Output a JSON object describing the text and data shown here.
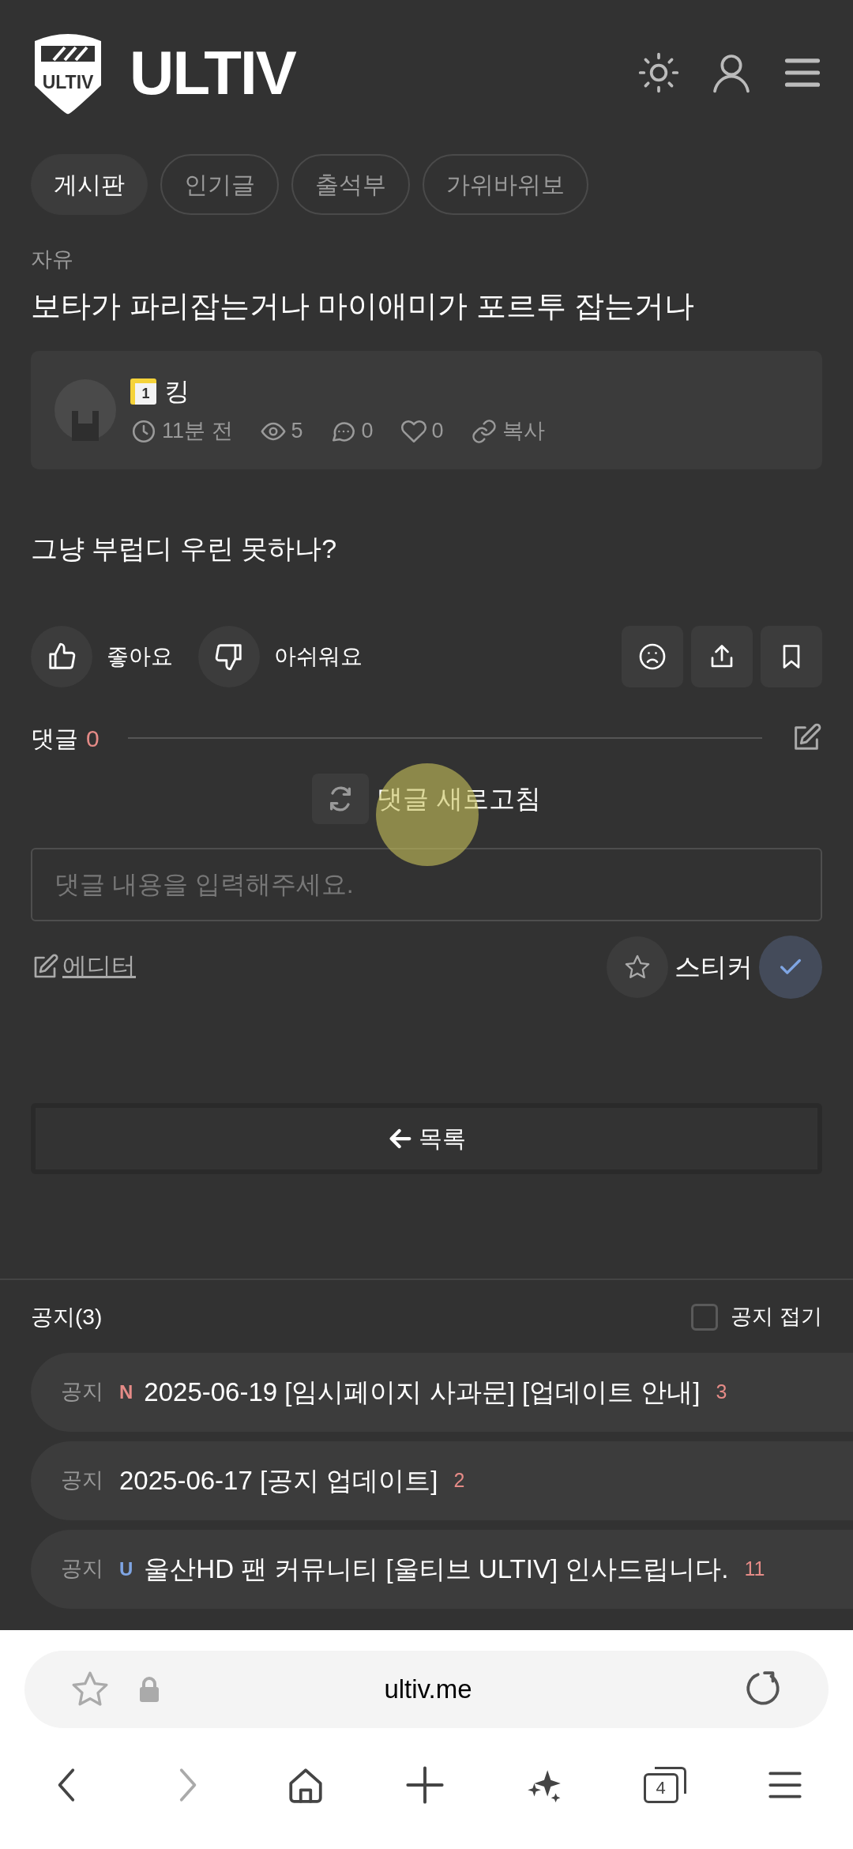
{
  "header": {
    "logo_badge": "ULTIV",
    "logo_text": "ULTIV"
  },
  "tabs": [
    {
      "label": "게시판",
      "selected": true
    },
    {
      "label": "인기글",
      "selected": false
    },
    {
      "label": "출석부",
      "selected": false
    },
    {
      "label": "가위바위보",
      "selected": false
    }
  ],
  "post": {
    "category": "자유",
    "title": "보타가 파리잡는거나 마이애미가 포르투 잡는거나",
    "author": {
      "level": "1",
      "name": "킹"
    },
    "time": "11분 전",
    "views": "5",
    "comments": "0",
    "likes": "0",
    "copy": "복사",
    "body": "그냥 부럽디 우린 못하나?"
  },
  "reactions": {
    "like": "좋아요",
    "dislike": "아쉬워요"
  },
  "comments": {
    "label": "댓글",
    "count": "0",
    "refresh": "댓글 새로고침",
    "placeholder": "댓글 내용을 입력해주세요.",
    "editor": "에디터",
    "sticker": "스티커"
  },
  "list_button": "목록",
  "notices": {
    "title": "공지(3)",
    "collapse": {
      "label": "공지 접기",
      "checked": false
    },
    "items": [
      {
        "tag": "공지",
        "badge": "N",
        "color": "#e58b87",
        "title": "2025-06-19 [임시페이지 사과문] [업데이트 안내]",
        "count": "3"
      },
      {
        "tag": "공지",
        "title": "2025-06-17 [공지 업데이트]",
        "count": "2"
      },
      {
        "tag": "공지",
        "badge": "U",
        "color": "#7fa5e3",
        "title": "울산HD 팬 커뮤니티 [울티브 ULTIV] 인사드립니다.",
        "count": "11"
      }
    ]
  },
  "browser": {
    "url": "ultiv.me",
    "tab_count": "4"
  }
}
